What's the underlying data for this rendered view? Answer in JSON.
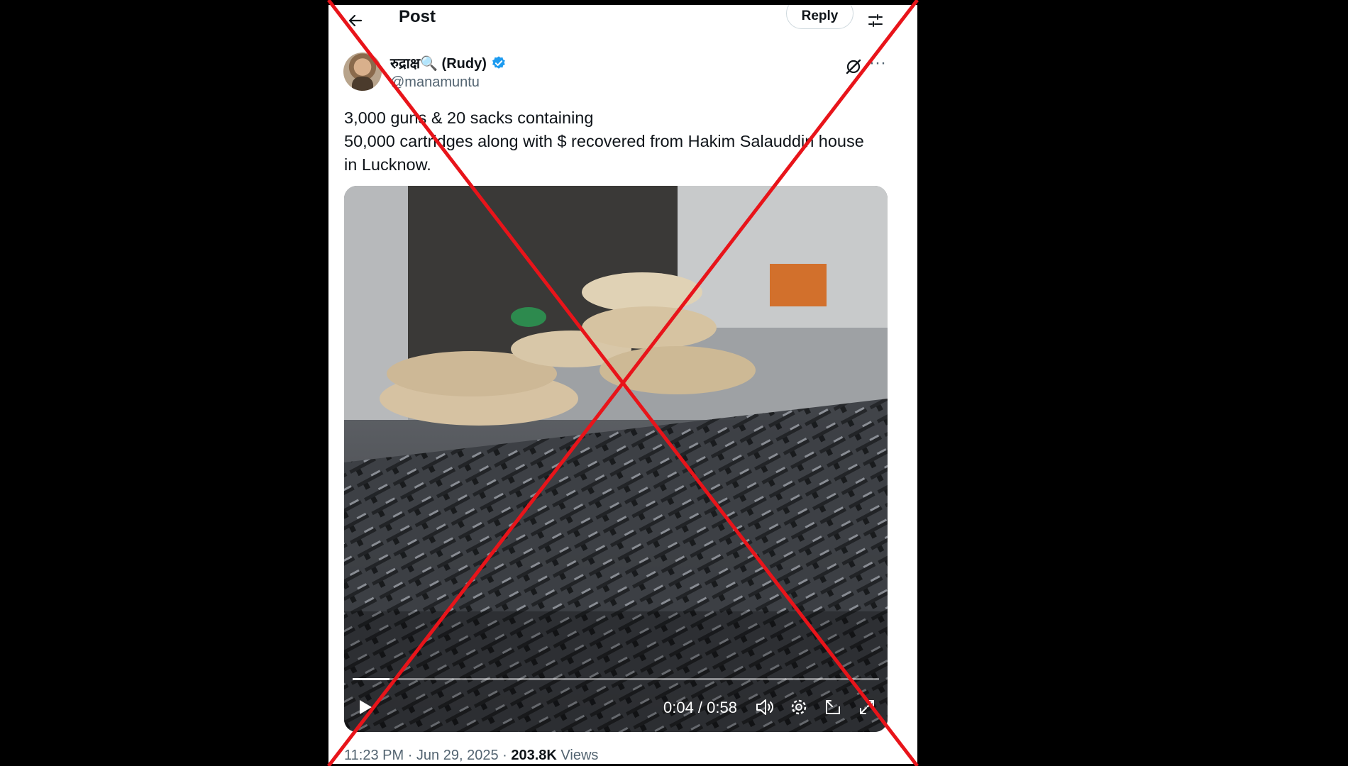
{
  "header": {
    "title": "Post",
    "reply_label": "Reply",
    "back_icon": "arrow-left-icon",
    "settings_icon": "sliders-icon"
  },
  "author": {
    "display_name": "रुद्राक्ष🔍 (Rudy)",
    "handle": "@manamuntu",
    "verified": true,
    "verified_color": "#1d9bf0"
  },
  "tweet": {
    "lines": [
      "3,000 guns & 20 sacks containing",
      "50,000 cartridges along with $ recovered from Hakim Salauddin house",
      "in Lucknow."
    ]
  },
  "video": {
    "elapsed": "0:04",
    "duration": "0:58",
    "time_display": "0:04 / 0:58",
    "progress_fraction": 0.07
  },
  "meta": {
    "time": "11:23 PM",
    "date": "Jun 29, 2025",
    "views_count": "203.8K",
    "views_label": "Views"
  },
  "overlay": {
    "cross_color": "#e8141a"
  }
}
